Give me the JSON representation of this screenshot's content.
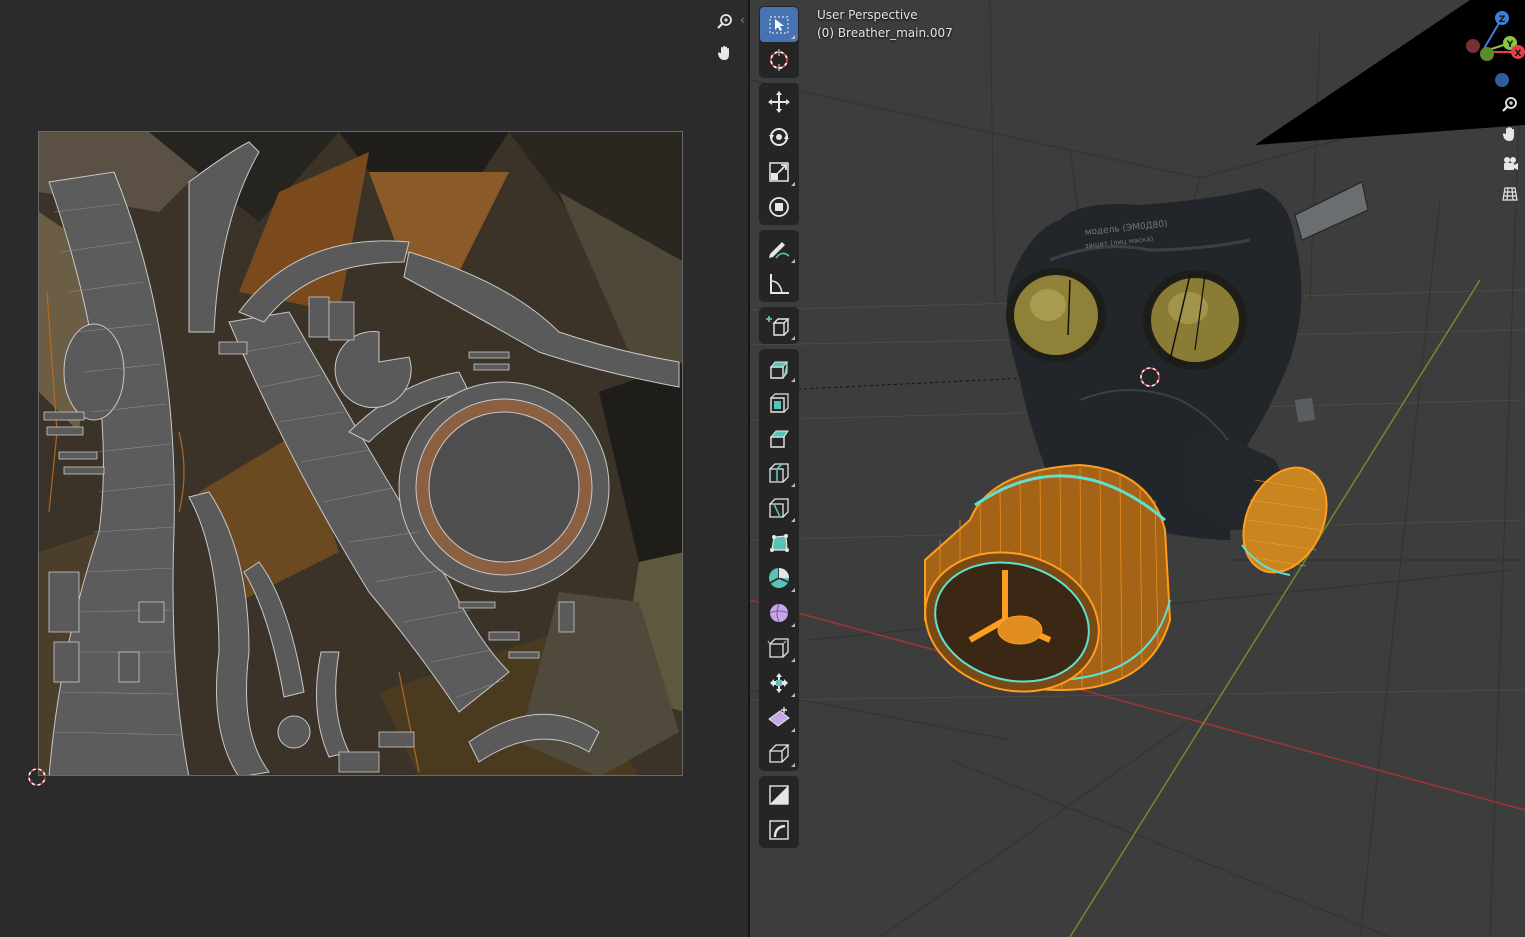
{
  "app": "Blender",
  "uv_editor": {
    "nav": [
      "zoom-icon",
      "pan-hand-icon"
    ],
    "collapse_glyph": "‹"
  },
  "viewport": {
    "view_name": "User Perspective",
    "object_name": "(0) Breather_main.007",
    "mask_labels": [
      "модель (ЭМ0Д80)",
      "защит (лиц маска)"
    ],
    "gizmo": {
      "axes": [
        "Z",
        "Y",
        "X"
      ],
      "colors": {
        "x": "#e5414d",
        "y": "#8cc63f",
        "z": "#3e7fd6"
      }
    },
    "nav_icons": [
      "zoom-icon",
      "pan-hand-icon",
      "camera-icon",
      "grid-ortho-icon"
    ],
    "toolbar_groups": [
      [
        "select-box-icon",
        "cursor-icon"
      ],
      [
        "move-icon",
        "rotate-icon",
        "scale-icon",
        "transform-icon"
      ],
      [
        "annotate-icon",
        "measure-icon"
      ],
      [
        "add-cube-icon"
      ],
      [
        "extrude-icon",
        "inset-icon",
        "bevel-icon",
        "loop-cut-icon",
        "knife-icon",
        "poly-build-icon",
        "spin-icon",
        "smooth-icon",
        "edge-slide-icon",
        "shrink-fatten-icon",
        "shear-icon",
        "rip-region-icon"
      ],
      [
        "shear-box-icon",
        "bend-icon"
      ]
    ]
  },
  "colors": {
    "accent": "#4772b3",
    "selection_orange": "#ff9d1e",
    "seam_cyan": "#5fe0d0",
    "x_axis_line": "#a3313a",
    "y_axis_line": "#6a8f2a"
  }
}
